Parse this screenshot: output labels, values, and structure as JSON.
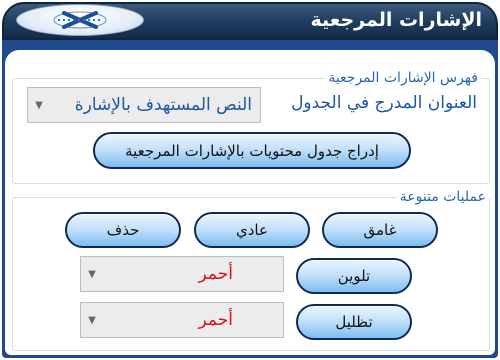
{
  "window": {
    "title": "الإشارات المرجعية",
    "logo_icon": "app-logo-icon"
  },
  "index_group": {
    "legend": "فهرس الإشارات المرجعية",
    "heading_label": "العنوان المدرج في الجدول",
    "heading_select_value": "النص المستهدف بالإشارة",
    "insert_button_label": "إدراج جدول محتويات بالإشارات المرجعية"
  },
  "misc_group": {
    "legend": "عمليات متنوعة",
    "bold_button_label": "غامق",
    "normal_button_label": "عادي",
    "delete_button_label": "حذف",
    "color_button_label": "تلوين",
    "color_select_value": "أحمر",
    "highlight_button_label": "تظليل",
    "highlight_select_value": "أحمر"
  },
  "colors": {
    "title_bar": "#1d3c5e",
    "frame": "#1f4a8c",
    "accent_text": "#1c56a8",
    "red_value": "#e01010",
    "button_gradient_bottom": "#7fbdf0"
  }
}
